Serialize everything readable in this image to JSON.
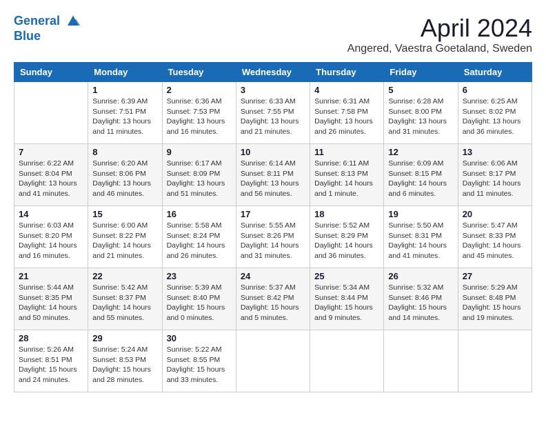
{
  "header": {
    "logo_line1": "General",
    "logo_line2": "Blue",
    "month_title": "April 2024",
    "location": "Angered, Vaestra Goetaland, Sweden"
  },
  "weekdays": [
    "Sunday",
    "Monday",
    "Tuesday",
    "Wednesday",
    "Thursday",
    "Friday",
    "Saturday"
  ],
  "weeks": [
    [
      {
        "day": "",
        "info": ""
      },
      {
        "day": "1",
        "info": "Sunrise: 6:39 AM\nSunset: 7:51 PM\nDaylight: 13 hours\nand 11 minutes."
      },
      {
        "day": "2",
        "info": "Sunrise: 6:36 AM\nSunset: 7:53 PM\nDaylight: 13 hours\nand 16 minutes."
      },
      {
        "day": "3",
        "info": "Sunrise: 6:33 AM\nSunset: 7:55 PM\nDaylight: 13 hours\nand 21 minutes."
      },
      {
        "day": "4",
        "info": "Sunrise: 6:31 AM\nSunset: 7:58 PM\nDaylight: 13 hours\nand 26 minutes."
      },
      {
        "day": "5",
        "info": "Sunrise: 6:28 AM\nSunset: 8:00 PM\nDaylight: 13 hours\nand 31 minutes."
      },
      {
        "day": "6",
        "info": "Sunrise: 6:25 AM\nSunset: 8:02 PM\nDaylight: 13 hours\nand 36 minutes."
      }
    ],
    [
      {
        "day": "7",
        "info": "Sunrise: 6:22 AM\nSunset: 8:04 PM\nDaylight: 13 hours\nand 41 minutes."
      },
      {
        "day": "8",
        "info": "Sunrise: 6:20 AM\nSunset: 8:06 PM\nDaylight: 13 hours\nand 46 minutes."
      },
      {
        "day": "9",
        "info": "Sunrise: 6:17 AM\nSunset: 8:09 PM\nDaylight: 13 hours\nand 51 minutes."
      },
      {
        "day": "10",
        "info": "Sunrise: 6:14 AM\nSunset: 8:11 PM\nDaylight: 13 hours\nand 56 minutes."
      },
      {
        "day": "11",
        "info": "Sunrise: 6:11 AM\nSunset: 8:13 PM\nDaylight: 14 hours\nand 1 minute."
      },
      {
        "day": "12",
        "info": "Sunrise: 6:09 AM\nSunset: 8:15 PM\nDaylight: 14 hours\nand 6 minutes."
      },
      {
        "day": "13",
        "info": "Sunrise: 6:06 AM\nSunset: 8:17 PM\nDaylight: 14 hours\nand 11 minutes."
      }
    ],
    [
      {
        "day": "14",
        "info": "Sunrise: 6:03 AM\nSunset: 8:20 PM\nDaylight: 14 hours\nand 16 minutes."
      },
      {
        "day": "15",
        "info": "Sunrise: 6:00 AM\nSunset: 8:22 PM\nDaylight: 14 hours\nand 21 minutes."
      },
      {
        "day": "16",
        "info": "Sunrise: 5:58 AM\nSunset: 8:24 PM\nDaylight: 14 hours\nand 26 minutes."
      },
      {
        "day": "17",
        "info": "Sunrise: 5:55 AM\nSunset: 8:26 PM\nDaylight: 14 hours\nand 31 minutes."
      },
      {
        "day": "18",
        "info": "Sunrise: 5:52 AM\nSunset: 8:29 PM\nDaylight: 14 hours\nand 36 minutes."
      },
      {
        "day": "19",
        "info": "Sunrise: 5:50 AM\nSunset: 8:31 PM\nDaylight: 14 hours\nand 41 minutes."
      },
      {
        "day": "20",
        "info": "Sunrise: 5:47 AM\nSunset: 8:33 PM\nDaylight: 14 hours\nand 45 minutes."
      }
    ],
    [
      {
        "day": "21",
        "info": "Sunrise: 5:44 AM\nSunset: 8:35 PM\nDaylight: 14 hours\nand 50 minutes."
      },
      {
        "day": "22",
        "info": "Sunrise: 5:42 AM\nSunset: 8:37 PM\nDaylight: 14 hours\nand 55 minutes."
      },
      {
        "day": "23",
        "info": "Sunrise: 5:39 AM\nSunset: 8:40 PM\nDaylight: 15 hours\nand 0 minutes."
      },
      {
        "day": "24",
        "info": "Sunrise: 5:37 AM\nSunset: 8:42 PM\nDaylight: 15 hours\nand 5 minutes."
      },
      {
        "day": "25",
        "info": "Sunrise: 5:34 AM\nSunset: 8:44 PM\nDaylight: 15 hours\nand 9 minutes."
      },
      {
        "day": "26",
        "info": "Sunrise: 5:32 AM\nSunset: 8:46 PM\nDaylight: 15 hours\nand 14 minutes."
      },
      {
        "day": "27",
        "info": "Sunrise: 5:29 AM\nSunset: 8:48 PM\nDaylight: 15 hours\nand 19 minutes."
      }
    ],
    [
      {
        "day": "28",
        "info": "Sunrise: 5:26 AM\nSunset: 8:51 PM\nDaylight: 15 hours\nand 24 minutes."
      },
      {
        "day": "29",
        "info": "Sunrise: 5:24 AM\nSunset: 8:53 PM\nDaylight: 15 hours\nand 28 minutes."
      },
      {
        "day": "30",
        "info": "Sunrise: 5:22 AM\nSunset: 8:55 PM\nDaylight: 15 hours\nand 33 minutes."
      },
      {
        "day": "",
        "info": ""
      },
      {
        "day": "",
        "info": ""
      },
      {
        "day": "",
        "info": ""
      },
      {
        "day": "",
        "info": ""
      }
    ]
  ]
}
